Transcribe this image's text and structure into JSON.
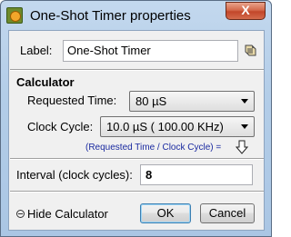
{
  "window": {
    "title": "One-Shot Timer properties",
    "close_symbol": "X"
  },
  "label_field": {
    "label": "Label:",
    "value": "One-Shot Timer"
  },
  "calculator": {
    "title": "Calculator",
    "requested_time": {
      "label": "Requested Time:",
      "value": "80 µS"
    },
    "clock_cycle": {
      "label": "Clock Cycle:",
      "value": "10.0 µS ( 100.00 KHz)"
    },
    "formula": "(Requested Time / Clock Cycle) ="
  },
  "interval": {
    "label": "Interval (clock cycles):",
    "value": "8"
  },
  "footer": {
    "hide_calculator": "Hide Calculator",
    "ok": "OK",
    "cancel": "Cancel"
  },
  "colors": {
    "title_bar": "#b3cde8",
    "close_button": "#c2462a",
    "formula_text": "#1a2aa0",
    "dialog_background": "#f0f0f0"
  },
  "icons": [
    "app-timer-icon",
    "close-icon",
    "tag-icon",
    "down-arrow-icon",
    "collapse-circle-icon",
    "dropdown-arrow-icon"
  ]
}
